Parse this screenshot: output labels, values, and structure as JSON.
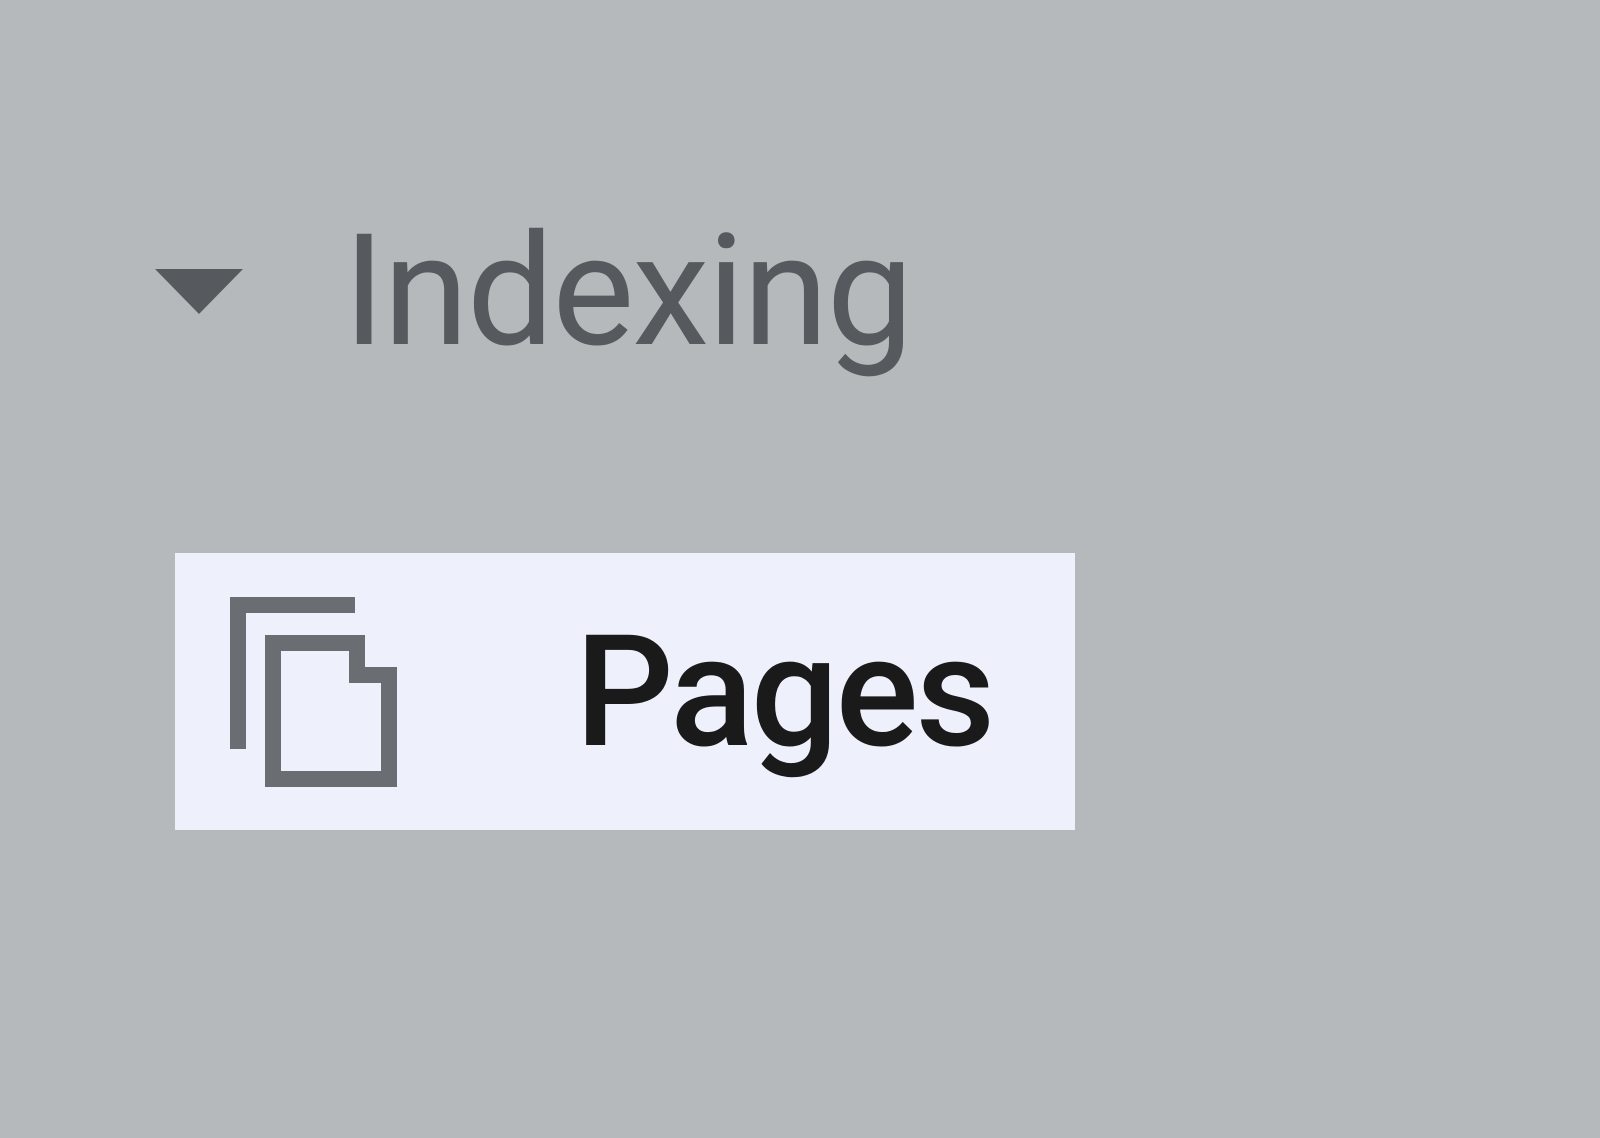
{
  "sidebar": {
    "section": {
      "title": "Indexing",
      "expanded": true
    },
    "items": [
      {
        "label": "Pages",
        "icon": "pages-icon",
        "selected": true
      }
    ]
  }
}
